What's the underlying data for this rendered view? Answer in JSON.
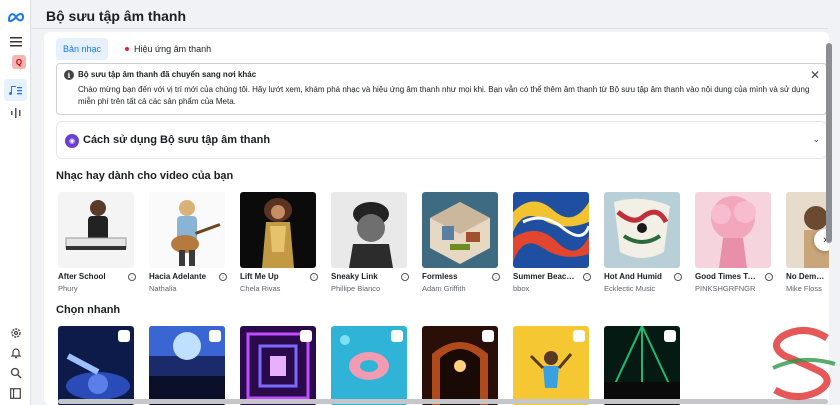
{
  "page": {
    "title": "Bộ sưu tập âm thanh"
  },
  "rail": {
    "icons": [
      "meta-logo-icon",
      "menu-icon",
      "q-badge-icon",
      "music-library-icon",
      "audio-waveform-icon",
      "settings-icon",
      "bell-icon",
      "search-icon",
      "help-panel-icon"
    ],
    "badge_letter": "Q",
    "accent": "#1877f2"
  },
  "tabs": [
    {
      "label": "Bản nhạc",
      "active": true
    },
    {
      "label": "Hiệu ứng âm thanh",
      "active": false
    }
  ],
  "notice": {
    "title": "Bộ sưu tập âm thanh đã chuyển sang nơi khác",
    "body": "Chào mừng bạn đến với vị trí mới của chúng tôi. Hãy lướt xem, khám phá nhạc và hiệu ứng âm thanh như mọi khi. Bạn vẫn có thể thêm âm thanh từ Bộ sưu tập âm thanh vào nội dung của mình và sử dụng miễn phí trên tất cả các sản phẩm của Meta."
  },
  "howto": {
    "label": "Cách sử dụng Bộ sưu tập âm thanh"
  },
  "music_section": {
    "title": "Nhạc hay dành cho video của bạn"
  },
  "tracks": [
    {
      "title": "After School",
      "artist": "Phury"
    },
    {
      "title": "Hacia Adelante",
      "artist": "Nathalia"
    },
    {
      "title": "Lift Me Up",
      "artist": "Chela Rivas"
    },
    {
      "title": "Sneaky Link",
      "artist": "Phillipe Bianco"
    },
    {
      "title": "Formless",
      "artist": "Adam Griffith"
    },
    {
      "title": "Summer Beach ...",
      "artist": "bbox"
    },
    {
      "title": "Hot And Humid",
      "artist": "Ecklectic Music"
    },
    {
      "title": "Good Times To...",
      "artist": "PINKSHGRFNGR"
    },
    {
      "title": "No Demons",
      "artist": "Mike Floss"
    }
  ],
  "quick_section": {
    "title": "Chọn nhanh"
  },
  "quick_picks": [
    "dj-turntable-image",
    "crowd-concert-image",
    "neon-tunnel-image",
    "pool-float-image",
    "stage-arch-image",
    "dancer-yellow-image",
    "party-crowd-image"
  ]
}
